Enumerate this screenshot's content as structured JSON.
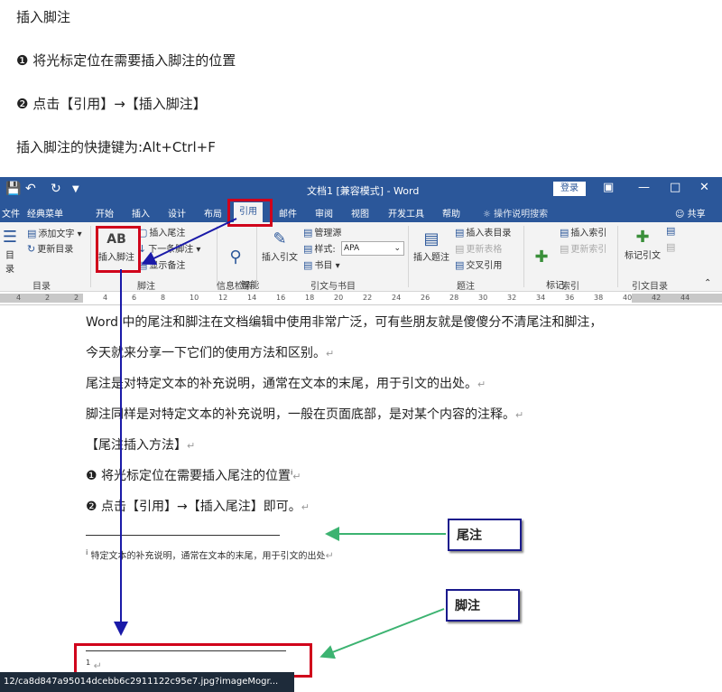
{
  "intro": {
    "title": "插入脚注",
    "step1": "❶ 将光标定位在需要插入脚注的位置",
    "step2": "❷ 点击【引用】→【插入脚注】",
    "shortcut": "插入脚注的快捷键为:Alt+Ctrl+F"
  },
  "word": {
    "title": "文档1 [兼容模式] - Word",
    "login": "登录",
    "tabs": [
      "文件",
      "经典菜单",
      "开始",
      "插入",
      "设计",
      "布局",
      "引用",
      "邮件",
      "审阅",
      "视图",
      "开发工具",
      "帮助"
    ],
    "tell_me": "操作说明搜索",
    "share": "共享",
    "ribbon": {
      "toc": "目录",
      "add_text": "添加文字",
      "update_toc": "更新目录",
      "group_toc": "目录",
      "insert_footnote_icon": "AB",
      "insert_footnote": "插入脚注",
      "insert_endnote": "插入尾注",
      "next_footnote": "下一条脚注",
      "show_notes": "显示备注",
      "group_footnote": "脚注",
      "smart_lookup": "智能\n查找",
      "group_info": "信息检索",
      "insert_citation": "插入引文",
      "manage_sources": "管理源",
      "style_label": "样式:",
      "style_value": "APA",
      "bibliography": "书目",
      "group_citation": "引文与书目",
      "insert_caption": "插入题注",
      "insert_table_of_figures": "插入表目录",
      "update_table": "更新表格",
      "cross_reference": "交叉引用",
      "group_caption": "题注",
      "mark_entry": "标记\n条目",
      "insert_index": "插入索引",
      "update_index": "更新索引",
      "group_index": "索引",
      "mark_citation": "标记引文",
      "group_toa": "引文目录"
    },
    "ruler_ticks": [
      "4",
      "2",
      "2",
      "4",
      "6",
      "8",
      "10",
      "12",
      "14",
      "16",
      "18",
      "20",
      "22",
      "24",
      "26",
      "28",
      "30",
      "32",
      "34",
      "36",
      "38",
      "40",
      "42",
      "44"
    ],
    "doc": {
      "p1": "Word 中的尾注和脚注在文档编辑中使用非常广泛，可有些朋友就是傻傻分不清尾注和脚注，",
      "p2": "今天就来分享一下它们的使用方法和区别。",
      "p3": "尾注是对特定文本的补充说明，通常在文本的末尾，用于引文的出处。",
      "p4": "脚注同样是对特定文本的补充说明，一般在页面底部，是对某个内容的注释。",
      "p5": "【尾注插入方法】",
      "p6": "❶ 将光标定位在需要插入尾注的位置",
      "p7": "❷ 点击【引用】→【插入尾注】即可。",
      "endnote_text": "特定文本的补充说明，通常在文本的末尾，用于引文的出处",
      "endnote_mark": "i",
      "footnote_mark": "1",
      "para_mark": "↵"
    },
    "callouts": {
      "endnote": "尾注",
      "footnote": "脚注"
    }
  },
  "status_url": "12/ca8d847a95014dcebb6c2911122c95e7.jpg?imageMogr...",
  "colors": {
    "word_blue": "#2b579a",
    "ribbon_bg": "#f3f3f3",
    "highlight_red": "#d0021b",
    "arrow_blue": "#1a1aa8",
    "arrow_green": "#3cb371"
  }
}
